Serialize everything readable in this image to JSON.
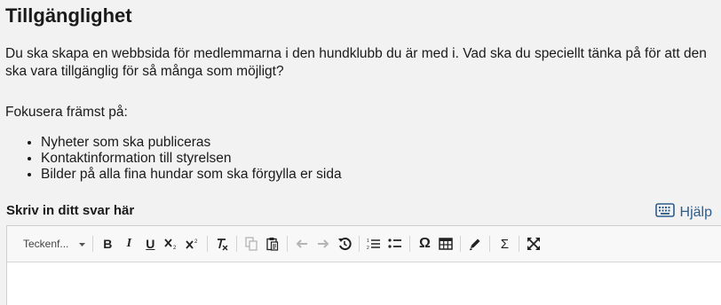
{
  "page": {
    "title": "Tillgänglighet",
    "intro": "Du ska skapa en webbsida för medlemmarna i den hundklubb du är med i. Vad ska du speciellt tänka på för att den ska vara tillgänglig för så många som möjligt?",
    "focus_label": "Fokusera främst på:",
    "focus_items": [
      "Nyheter som ska publiceras",
      "Kontaktinformation till styrelsen",
      "Bilder på alla fina hundar som ska förgylla er sida"
    ]
  },
  "answer": {
    "label": "Skriv in ditt svar här",
    "help_label": "Hjälp",
    "help_icon": "keyboard-icon"
  },
  "toolbar": {
    "font_label": "Teckenf...",
    "bold": "B",
    "italic": "I",
    "underline": "U",
    "omega": "Ω",
    "sigma": "Σ"
  },
  "colors": {
    "background": "#f2f2f2",
    "link": "#2f5d8a",
    "disabled": "#b5b5b5"
  }
}
